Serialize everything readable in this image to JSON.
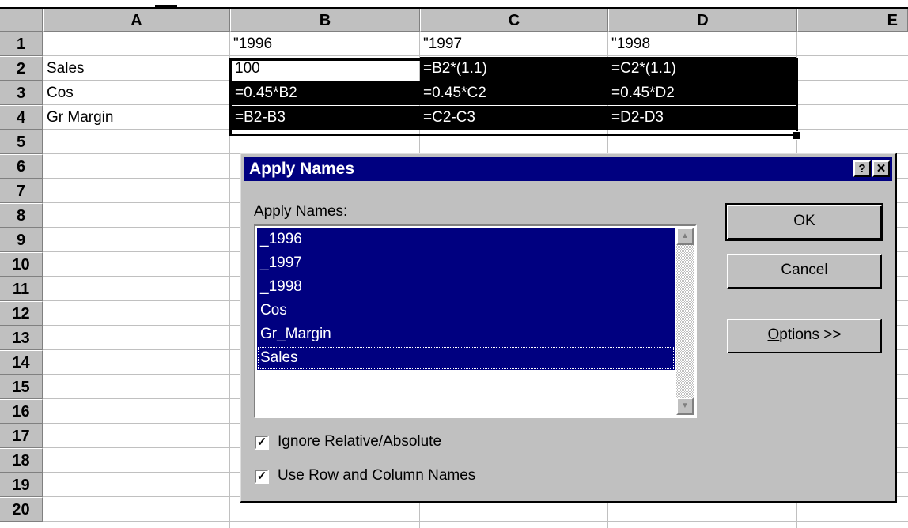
{
  "sheet": {
    "columns": [
      "A",
      "B",
      "C",
      "D",
      "E"
    ],
    "rows": [
      "1",
      "2",
      "3",
      "4",
      "5",
      "6",
      "7",
      "8",
      "9",
      "10",
      "11",
      "12",
      "13",
      "14",
      "15",
      "16",
      "17",
      "18",
      "19",
      "20"
    ],
    "cells": {
      "B1": "\"1996",
      "C1": "\"1997",
      "D1": "\"1998",
      "A2": "Sales",
      "B2": "100",
      "C2": "=B2*(1.1)",
      "D2": "=C2*(1.1)",
      "A3": "Cos",
      "B3": "=0.45*B2",
      "C3": "=0.45*C2",
      "D3": "=0.45*D2",
      "A4": "Gr Margin",
      "B4": "=B2-B3",
      "C4": "=C2-C3",
      "D4": "=D2-D3"
    }
  },
  "dialog": {
    "title": "Apply Names",
    "help_glyph": "?",
    "close_glyph": "✕",
    "list_label_pre": "Apply ",
    "list_label_key": "N",
    "list_label_post": "ames:",
    "names": [
      "_1996",
      "_1997",
      "_1998",
      "Cos",
      "Gr_Margin",
      "Sales"
    ],
    "ok_label": "OK",
    "cancel_label": "Cancel",
    "options_key": "O",
    "options_rest": "ptions >>",
    "ignore_key": "I",
    "ignore_rest": "gnore Relative/Absolute",
    "ignore_checked": true,
    "use_key": "U",
    "use_rest": "se Row and Column Names",
    "use_checked": true,
    "scroll_up_glyph": "▲",
    "scroll_down_glyph": "▼"
  }
}
